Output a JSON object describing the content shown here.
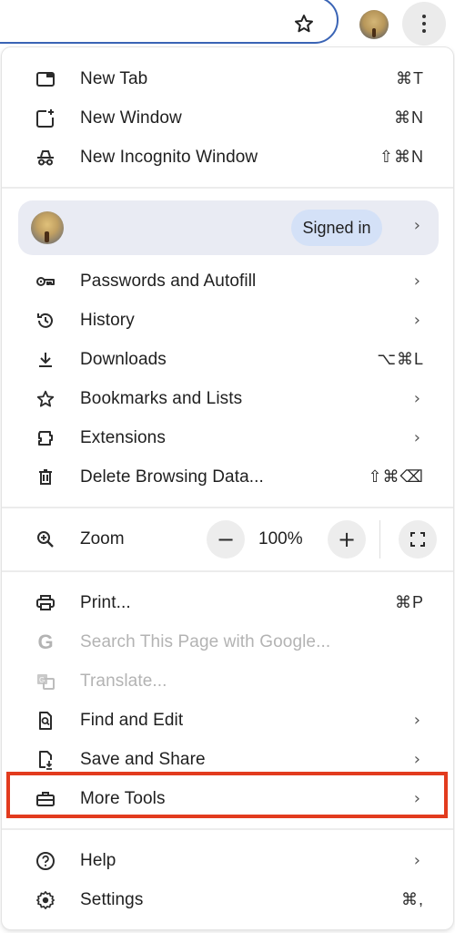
{
  "toolbar": {
    "bookmark_icon": "star-outline-icon",
    "profile_avatar": "profile-avatar",
    "menu_icon": "three-dot-vertical-icon"
  },
  "menu": {
    "group1": [
      {
        "label": "New Tab",
        "shortcut": "⌘T",
        "icon": "new-tab-icon"
      },
      {
        "label": "New Window",
        "shortcut": "⌘N",
        "icon": "new-window-icon"
      },
      {
        "label": "New Incognito Window",
        "shortcut": "⇧⌘N",
        "icon": "incognito-icon"
      }
    ],
    "profile": {
      "status": "Signed in",
      "chevron": "›"
    },
    "group2": [
      {
        "label": "Passwords and Autofill",
        "chevron": "›",
        "icon": "key-icon"
      },
      {
        "label": "History",
        "chevron": "›",
        "icon": "history-icon"
      },
      {
        "label": "Downloads",
        "shortcut": "⌥⌘L",
        "icon": "download-icon"
      },
      {
        "label": "Bookmarks and Lists",
        "chevron": "›",
        "icon": "star-icon"
      },
      {
        "label": "Extensions",
        "chevron": "›",
        "icon": "puzzle-icon"
      },
      {
        "label": "Delete Browsing Data...",
        "shortcut": "⇧⌘⌫",
        "icon": "trash-icon"
      }
    ],
    "zoom": {
      "label": "Zoom",
      "value": "100%",
      "minus": "−",
      "plus": "+"
    },
    "group3": [
      {
        "label": "Print...",
        "shortcut": "⌘P",
        "icon": "printer-icon"
      },
      {
        "label": "Search This Page with Google...",
        "icon": "google-g-icon",
        "disabled": true
      },
      {
        "label": "Translate...",
        "icon": "translate-icon",
        "disabled": true
      },
      {
        "label": "Find and Edit",
        "chevron": "›",
        "icon": "find-page-icon"
      },
      {
        "label": "Save and Share",
        "chevron": "›",
        "icon": "save-page-icon"
      },
      {
        "label": "More Tools",
        "chevron": "›",
        "icon": "toolbox-icon",
        "highlighted": true
      }
    ],
    "group4": [
      {
        "label": "Help",
        "chevron": "›",
        "icon": "help-circle-icon"
      },
      {
        "label": "Settings",
        "shortcut": "⌘,",
        "icon": "gear-icon"
      }
    ]
  },
  "colors": {
    "highlight_box": "#e23b1e",
    "signed_in_pill": "#d4e1f7",
    "profile_row": "#e9ebf3",
    "omnibox_border": "#3a64b5",
    "disabled_text": "#b3b3b3"
  }
}
